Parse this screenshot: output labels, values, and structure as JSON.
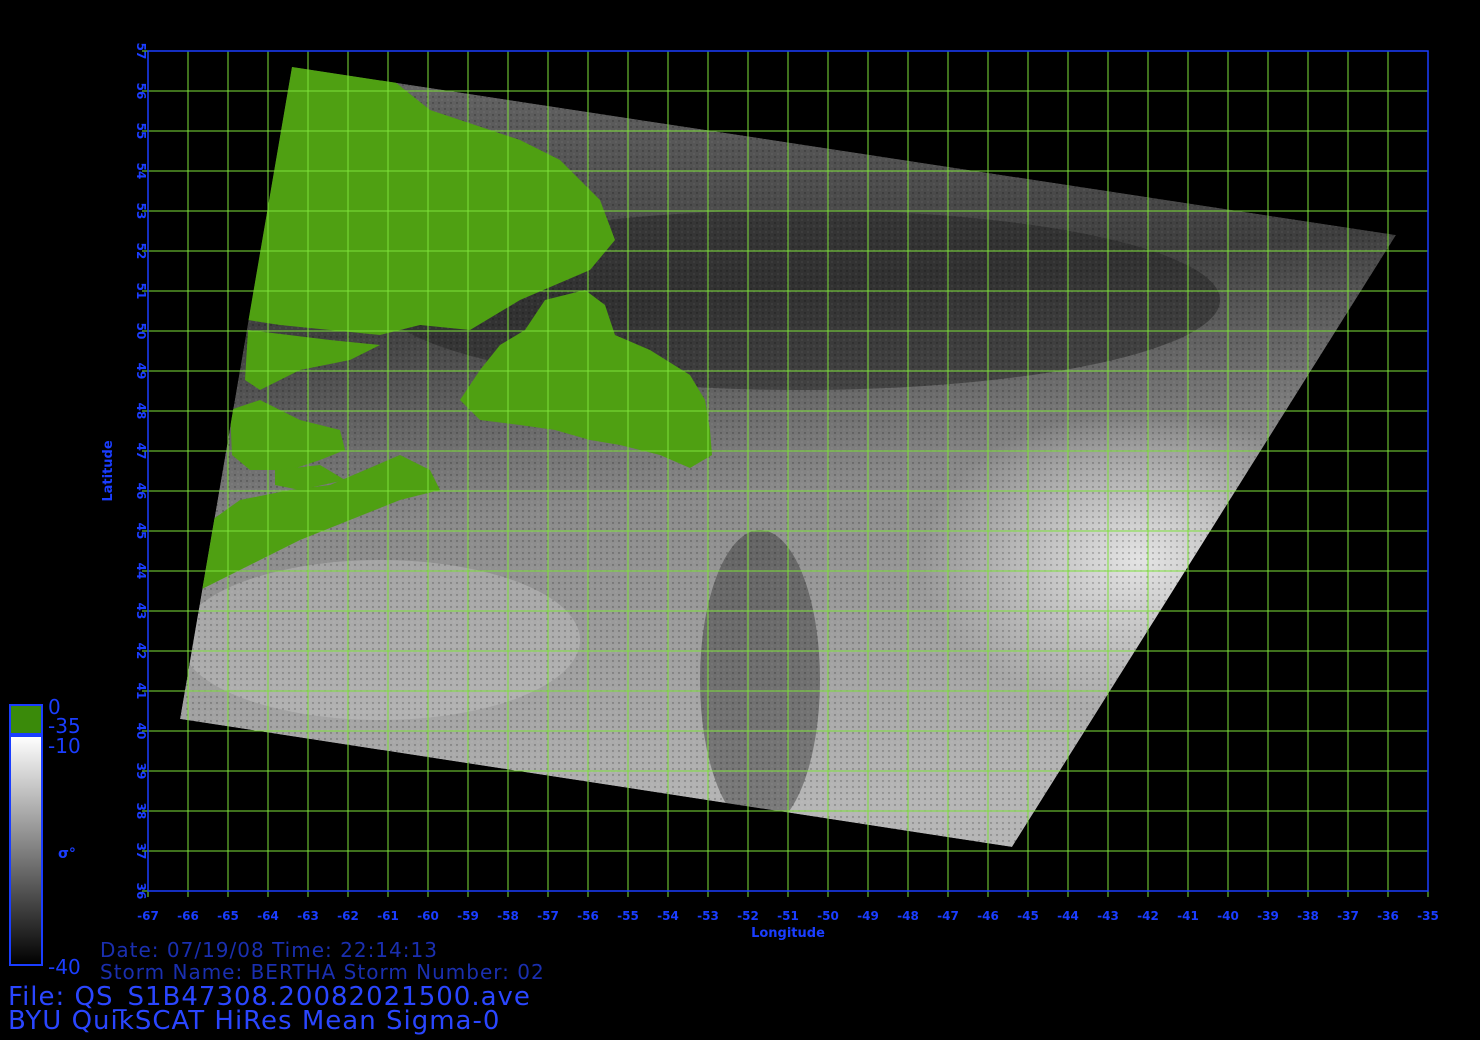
{
  "map": {
    "x_axis_label": "Longitude",
    "y_axis_label": "Latitude",
    "lon_range": [
      -67,
      -35
    ],
    "lat_range": [
      36,
      57
    ],
    "lon_ticks": [
      "-67",
      "-66",
      "-65",
      "-64",
      "-63",
      "-62",
      "-61",
      "-60",
      "-59",
      "-58",
      "-57",
      "-56",
      "-55",
      "-54",
      "-53",
      "-52",
      "-51",
      "-50",
      "-49",
      "-48",
      "-47",
      "-46",
      "-45",
      "-44",
      "-43",
      "-42",
      "-41",
      "-40",
      "-39",
      "-38",
      "-37",
      "-36",
      "-35"
    ],
    "lat_ticks": [
      "36",
      "37",
      "38",
      "39",
      "40",
      "41",
      "42",
      "43",
      "44",
      "45",
      "46",
      "47",
      "48",
      "49",
      "50",
      "51",
      "52",
      "53",
      "54",
      "55",
      "56",
      "57"
    ],
    "grid_color": "#7ee23a",
    "axis_color": "#1a3dff",
    "land_color": "#4fa012",
    "swath_corners_lonlat": [
      [
        -63.4,
        56.6
      ],
      [
        -35.8,
        52.4
      ],
      [
        -45.4,
        37.1
      ],
      [
        -66.2,
        40.3
      ]
    ]
  },
  "colorbar": {
    "land_value": "0",
    "land_bottom": "-35",
    "top_value": "-10",
    "bottom_value": "-40",
    "symbol": "σ°",
    "land_color": "#3a8a0a"
  },
  "info": {
    "date_line": "Date: 07/19/08   Time: 22:14:13",
    "storm_line": "Storm Name: BERTHA   Storm Number: 02",
    "file_line": "File: QS_S1B47308.20082021500.ave",
    "product_line": "BYU QuikSCAT HiRes Mean Sigma-0"
  }
}
